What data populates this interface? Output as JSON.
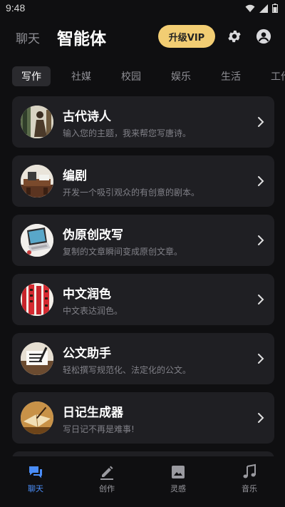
{
  "status_bar": {
    "time": "9:48"
  },
  "header": {
    "chat_tab": "聊天",
    "title": "智能体",
    "vip_label": "升级VIP"
  },
  "categories": [
    "写作",
    "社媒",
    "校园",
    "娱乐",
    "生活",
    "工作"
  ],
  "cards": [
    {
      "title": "古代诗人",
      "desc": "输入您的主题，我来帮您写唐诗。",
      "icon": "ancient-poet-thumbnail"
    },
    {
      "title": "编剧",
      "desc": "开发一个吸引观众的有创意的剧本。",
      "icon": "screenwriter-desk-thumbnail"
    },
    {
      "title": "伪原创改写",
      "desc": "复制的文章瞬间变成原创文章。",
      "icon": "laptop-thumbnail"
    },
    {
      "title": "中文润色",
      "desc": "中文表达润色。",
      "icon": "red-couplets-thumbnail"
    },
    {
      "title": "公文助手",
      "desc": "轻松撰写规范化、法定化的公文。",
      "icon": "document-desk-thumbnail"
    },
    {
      "title": "日记生成器",
      "desc": "写日记不再是难事!",
      "icon": "diary-book-thumbnail"
    }
  ],
  "bottom_nav": [
    {
      "label": "聊天",
      "icon": "chat-icon",
      "active": true
    },
    {
      "label": "创作",
      "icon": "pencil-icon",
      "active": false
    },
    {
      "label": "灵感",
      "icon": "image-icon",
      "active": false
    },
    {
      "label": "音乐",
      "icon": "music-note-icon",
      "active": false
    }
  ],
  "colors": {
    "background": "#0f0f11",
    "card": "#1f1f23",
    "vip": "#f2cd73",
    "accent": "#4a8df8"
  }
}
